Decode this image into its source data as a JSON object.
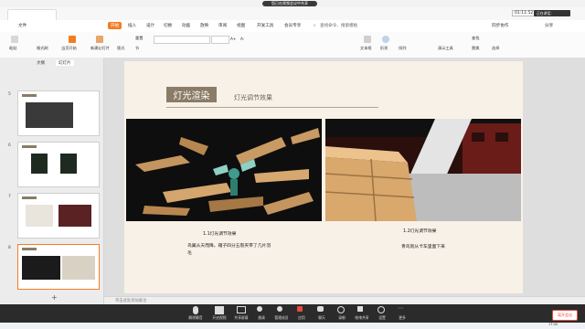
{
  "meeting": {
    "share_title": "您已在视频会议中共享"
  },
  "tabs": {
    "doc": "文件"
  },
  "menu": {
    "file": "文件",
    "start": "开始",
    "insert": "插入",
    "design": "设计",
    "transition": "切换",
    "animation": "动画",
    "show": "放映",
    "review": "审阅",
    "view": "视图",
    "dev": "开发工具",
    "vip": "会员专享",
    "search": "查找命令、搜索模板",
    "sync": "同步协作",
    "share": "分享"
  },
  "toolbar": {
    "paste": "粘贴",
    "format": "格式刷",
    "from_current": "当页开始",
    "new_slide": "新建幻灯片",
    "layout": "版式",
    "section": "节",
    "reset": "重置",
    "text_box": "文本框",
    "shape": "形状",
    "arrange": "排列",
    "find": "查找",
    "replace": "替换",
    "select": "选择",
    "demo": "演示工具",
    "font_size_up": "A+",
    "font_size_down": "A-"
  },
  "sidebar": {
    "outline_tab": "大纲",
    "slides_tab": "幻灯片",
    "numbers": [
      "5",
      "6",
      "7",
      "8"
    ],
    "add": "+"
  },
  "slide": {
    "title": "灯光渲染",
    "subtitle": "灯光调节效果",
    "caption1": "1.1灯光调节效果",
    "desc1": "鸟翼从天而降，箱子四分五裂夹带了几片羽毛",
    "caption2": "1.2灯光调节效果",
    "desc2": "青鸟就从卡车里面下来"
  },
  "notes": {
    "placeholder": "单击此处添加备注"
  },
  "dock": {
    "items": [
      "解除静音",
      "开启视频",
      "共享屏幕",
      "邀请",
      "管理成员",
      "应用",
      "聊天",
      "录制",
      "结束共享",
      "设置",
      "更多"
    ],
    "end": "离开会议"
  },
  "status": {
    "time": "01:11:52",
    "recording": "正在讲话：",
    "clock": "17:40",
    "date": "2021/3/26"
  },
  "colors": {
    "accent": "#f57c22",
    "title_box": "#8a7c66",
    "slide_bg": "#f8f1e8",
    "end": "#e94b3c"
  }
}
